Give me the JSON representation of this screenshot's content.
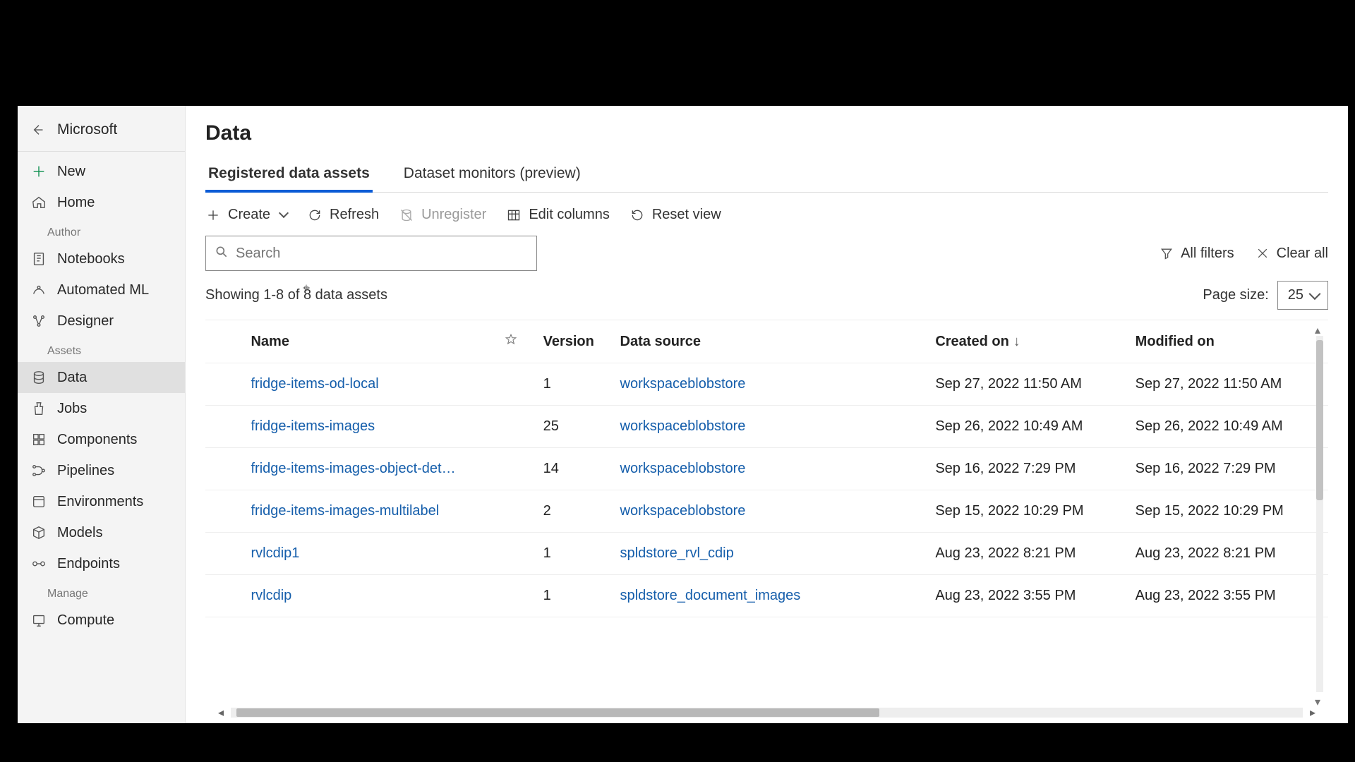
{
  "brand": "Microsoft",
  "sidebar": {
    "new": "New",
    "home": "Home",
    "sections": {
      "author": "Author",
      "assets": "Assets",
      "manage": "Manage"
    },
    "author_items": [
      "Notebooks",
      "Automated ML",
      "Designer"
    ],
    "asset_items": [
      "Data",
      "Jobs",
      "Components",
      "Pipelines",
      "Environments",
      "Models",
      "Endpoints"
    ],
    "manage_items": [
      "Compute"
    ]
  },
  "page": {
    "title": "Data"
  },
  "tabs": [
    {
      "label": "Registered data assets",
      "active": true
    },
    {
      "label": "Dataset monitors (preview)",
      "active": false
    }
  ],
  "toolbar": {
    "create": "Create",
    "refresh": "Refresh",
    "unregister": "Unregister",
    "edit_columns": "Edit columns",
    "reset_view": "Reset view"
  },
  "search": {
    "placeholder": "Search"
  },
  "filters": {
    "all_filters": "All filters",
    "clear_all": "Clear all"
  },
  "results_text": "Showing 1-8 of 8 data assets",
  "page_size": {
    "label": "Page size:",
    "value": "25"
  },
  "columns": {
    "name": "Name",
    "version": "Version",
    "data_source": "Data source",
    "created_on": "Created on",
    "modified_on": "Modified on"
  },
  "rows": [
    {
      "name": "fridge-items-od-local",
      "version": "1",
      "data_source": "workspaceblobstore",
      "created": "Sep 27, 2022 11:50 AM",
      "modified": "Sep 27, 2022 11:50 AM"
    },
    {
      "name": "fridge-items-images",
      "version": "25",
      "data_source": "workspaceblobstore",
      "created": "Sep 26, 2022 10:49 AM",
      "modified": "Sep 26, 2022 10:49 AM"
    },
    {
      "name": "fridge-items-images-object-det…",
      "version": "14",
      "data_source": "workspaceblobstore",
      "created": "Sep 16, 2022 7:29 PM",
      "modified": "Sep 16, 2022 7:29 PM"
    },
    {
      "name": "fridge-items-images-multilabel",
      "version": "2",
      "data_source": "workspaceblobstore",
      "created": "Sep 15, 2022 10:29 PM",
      "modified": "Sep 15, 2022 10:29 PM"
    },
    {
      "name": "rvlcdip1",
      "version": "1",
      "data_source": "spldstore_rvl_cdip",
      "created": "Aug 23, 2022 8:21 PM",
      "modified": "Aug 23, 2022 8:21 PM"
    },
    {
      "name": "rvlcdip",
      "version": "1",
      "data_source": "spldstore_document_images",
      "created": "Aug 23, 2022 3:55 PM",
      "modified": "Aug 23, 2022 3:55 PM"
    }
  ]
}
